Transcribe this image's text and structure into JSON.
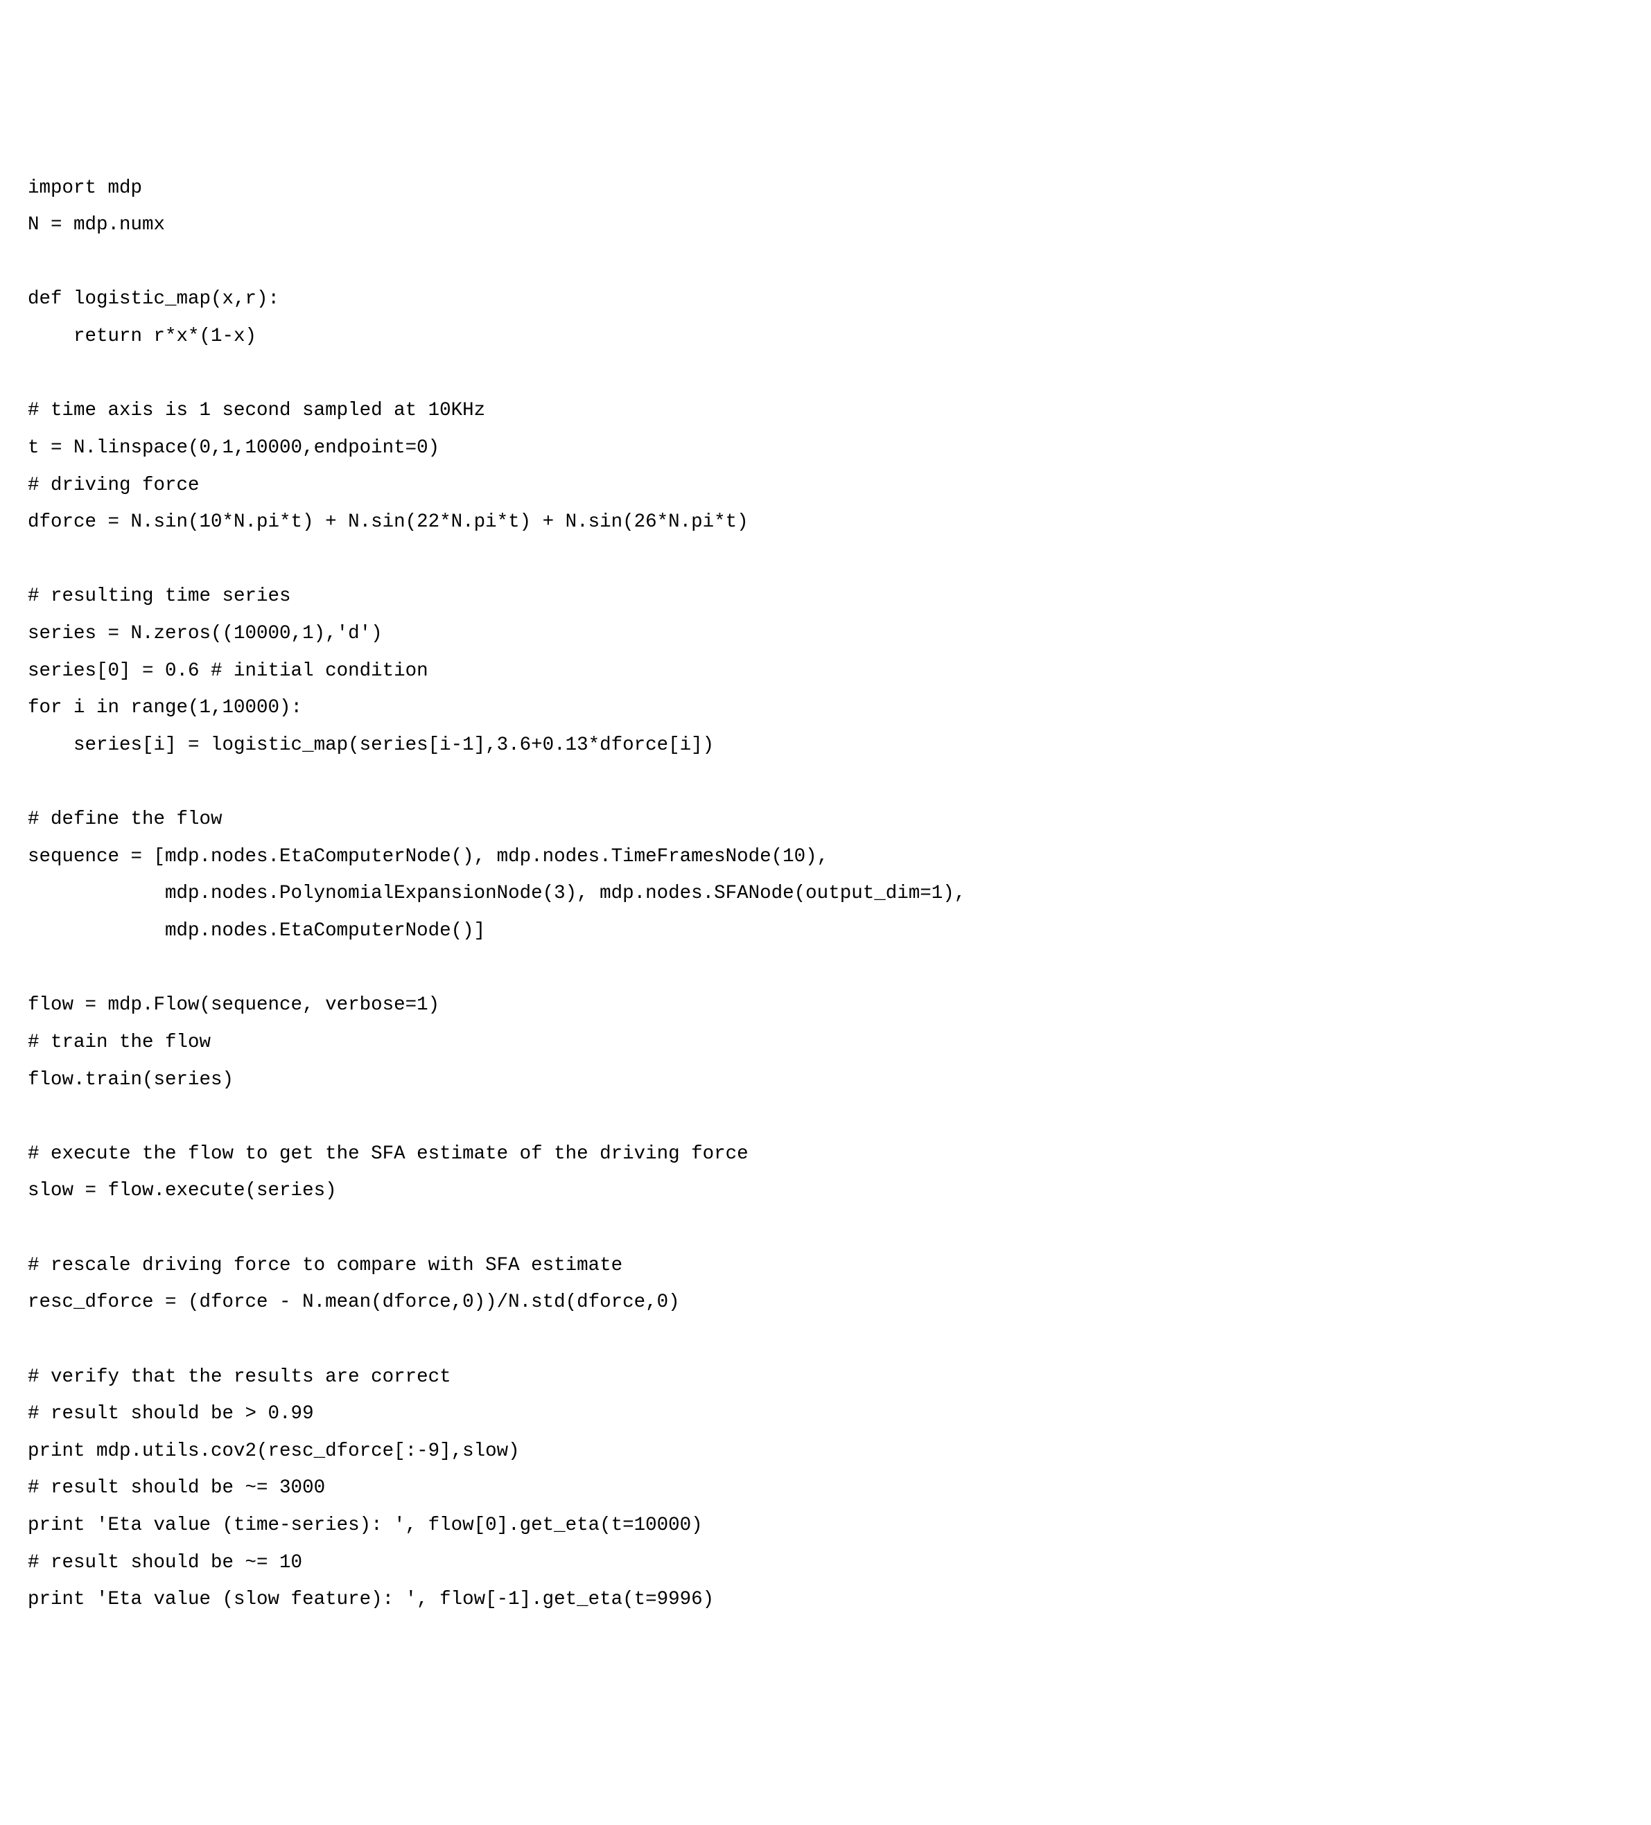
{
  "code": {
    "lines": [
      "import mdp",
      "N = mdp.numx",
      "",
      "def logistic_map(x,r):",
      "    return r*x*(1-x)",
      "",
      "# time axis is 1 second sampled at 10KHz",
      "t = N.linspace(0,1,10000,endpoint=0)",
      "# driving force",
      "dforce = N.sin(10*N.pi*t) + N.sin(22*N.pi*t) + N.sin(26*N.pi*t)",
      "",
      "# resulting time series",
      "series = N.zeros((10000,1),'d')",
      "series[0] = 0.6 # initial condition",
      "for i in range(1,10000):",
      "    series[i] = logistic_map(series[i-1],3.6+0.13*dforce[i])",
      "",
      "# define the flow",
      "sequence = [mdp.nodes.EtaComputerNode(), mdp.nodes.TimeFramesNode(10),",
      "            mdp.nodes.PolynomialExpansionNode(3), mdp.nodes.SFANode(output_dim=1),",
      "            mdp.nodes.EtaComputerNode()]",
      "",
      "flow = mdp.Flow(sequence, verbose=1)",
      "# train the flow",
      "flow.train(series)",
      "",
      "# execute the flow to get the SFA estimate of the driving force",
      "slow = flow.execute(series)",
      "",
      "# rescale driving force to compare with SFA estimate",
      "resc_dforce = (dforce - N.mean(dforce,0))/N.std(dforce,0)",
      "",
      "# verify that the results are correct",
      "# result should be > 0.99",
      "print mdp.utils.cov2(resc_dforce[:-9],slow)",
      "# result should be ~= 3000",
      "print 'Eta value (time-series): ', flow[0].get_eta(t=10000)",
      "# result should be ~= 10",
      "print 'Eta value (slow feature): ', flow[-1].get_eta(t=9996)"
    ]
  }
}
